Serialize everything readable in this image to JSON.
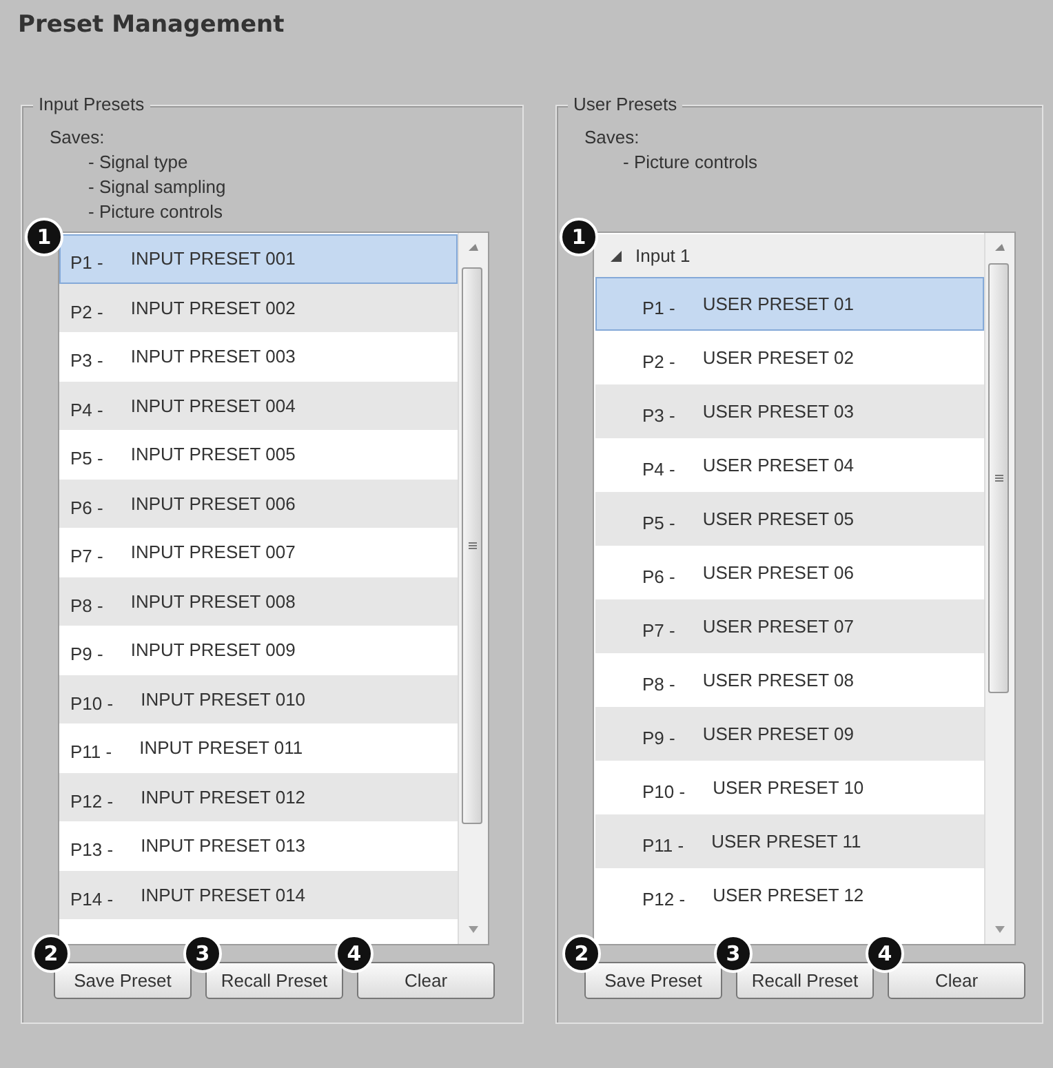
{
  "title": "Preset Management",
  "groups": [
    {
      "kind": "flat",
      "legend": "Input Presets",
      "saves_label": "Saves:",
      "saves": [
        "- Signal type",
        "- Signal sampling",
        "- Picture controls"
      ],
      "list_badge": "1",
      "items": [
        {
          "code": "P1 -",
          "name": "INPUT PRESET 001",
          "selected": true
        },
        {
          "code": "P2 -",
          "name": "INPUT PRESET 002",
          "selected": false
        },
        {
          "code": "P3 -",
          "name": "INPUT PRESET 003",
          "selected": false
        },
        {
          "code": "P4 -",
          "name": "INPUT PRESET 004",
          "selected": false
        },
        {
          "code": "P5 -",
          "name": "INPUT PRESET 005",
          "selected": false
        },
        {
          "code": "P6 -",
          "name": "INPUT PRESET 006",
          "selected": false
        },
        {
          "code": "P7 -",
          "name": "INPUT PRESET 007",
          "selected": false
        },
        {
          "code": "P8 -",
          "name": "INPUT PRESET 008",
          "selected": false
        },
        {
          "code": "P9 -",
          "name": "INPUT PRESET 009",
          "selected": false
        },
        {
          "code": "P10 -",
          "name": "INPUT PRESET 010",
          "selected": false
        },
        {
          "code": "P11 -",
          "name": "INPUT PRESET 011",
          "selected": false
        },
        {
          "code": "P12 -",
          "name": "INPUT PRESET 012",
          "selected": false
        },
        {
          "code": "P13 -",
          "name": "INPUT PRESET 013",
          "selected": false
        },
        {
          "code": "P14 -",
          "name": "INPUT PRESET 014",
          "selected": false
        }
      ],
      "buttons": [
        {
          "label": "Save Preset",
          "badge": "2"
        },
        {
          "label": "Recall Preset",
          "badge": "3"
        },
        {
          "label": "Clear",
          "badge": "4"
        }
      ]
    },
    {
      "kind": "tree",
      "legend": "User Presets",
      "saves_label": "Saves:",
      "saves": [
        "- Picture controls"
      ],
      "list_badge": "1",
      "tree": {
        "label": "Input 1",
        "expanded": true,
        "children": [
          {
            "code": "P1 -",
            "name": "USER PRESET 01",
            "selected": true
          },
          {
            "code": "P2 -",
            "name": "USER PRESET 02",
            "selected": false
          },
          {
            "code": "P3 -",
            "name": "USER PRESET 03",
            "selected": false
          },
          {
            "code": "P4 -",
            "name": "USER PRESET 04",
            "selected": false
          },
          {
            "code": "P5 -",
            "name": "USER PRESET 05",
            "selected": false
          },
          {
            "code": "P6 -",
            "name": "USER PRESET 06",
            "selected": false
          },
          {
            "code": "P7 -",
            "name": "USER PRESET 07",
            "selected": false
          },
          {
            "code": "P8 -",
            "name": "USER PRESET 08",
            "selected": false
          },
          {
            "code": "P9 -",
            "name": "USER PRESET 09",
            "selected": false
          },
          {
            "code": "P10 -",
            "name": "USER PRESET 10",
            "selected": false
          },
          {
            "code": "P11 -",
            "name": "USER PRESET 11",
            "selected": false
          },
          {
            "code": "P12 -",
            "name": "USER PRESET 12",
            "selected": false
          }
        ]
      },
      "buttons": [
        {
          "label": "Save Preset",
          "badge": "2"
        },
        {
          "label": "Recall Preset",
          "badge": "3"
        },
        {
          "label": "Clear",
          "badge": "4"
        }
      ]
    }
  ]
}
